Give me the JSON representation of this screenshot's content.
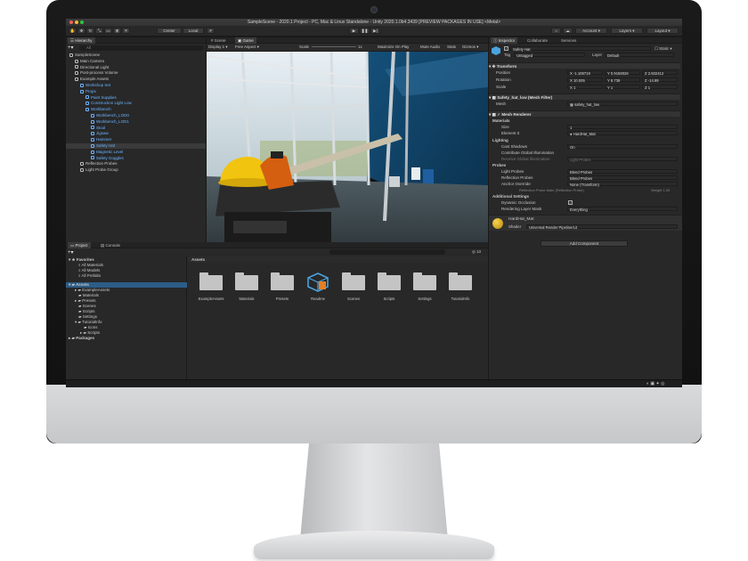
{
  "window_title": "SampleScene - 2020.1 Project - PC, Mac & Linux Standalone - Unity 2020.1.0b4.3439 [PREVIEW PACKAGES IN USE] <Metal>",
  "toolbar": {
    "center_label": "Center",
    "local_label": "Local",
    "account_label": "Account",
    "layers_label": "Layers",
    "layout_label": "Layout"
  },
  "hierarchy": {
    "tab": "Hierarchy",
    "search_placeholder": "All",
    "items": [
      {
        "label": "SampleScene",
        "indent": 0,
        "blue": false
      },
      {
        "label": "Main Camera",
        "indent": 1,
        "blue": false
      },
      {
        "label": "Directional Light",
        "indent": 1,
        "blue": false
      },
      {
        "label": "Post-process Volume",
        "indent": 1,
        "blue": false
      },
      {
        "label": "Example Assets",
        "indent": 1,
        "blue": false
      },
      {
        "label": "Workshop Set",
        "indent": 2,
        "blue": true
      },
      {
        "label": "Props",
        "indent": 2,
        "blue": true
      },
      {
        "label": "Paint Supplies",
        "indent": 3,
        "blue": true
      },
      {
        "label": "Construction Light Low",
        "indent": 3,
        "blue": true
      },
      {
        "label": "Workbench",
        "indent": 3,
        "blue": true
      },
      {
        "label": "Workbench_LOD0",
        "indent": 4,
        "blue": true
      },
      {
        "label": "Workbench_LOD1",
        "indent": 4,
        "blue": true
      },
      {
        "label": "Stool",
        "indent": 4,
        "blue": true
      },
      {
        "label": "Jigsaw",
        "indent": 4,
        "blue": true
      },
      {
        "label": "Hammer",
        "indent": 4,
        "blue": true
      },
      {
        "label": "Safety Hat",
        "indent": 4,
        "blue": true
      },
      {
        "label": "Magnetic Level",
        "indent": 4,
        "blue": true
      },
      {
        "label": "Safety Goggles",
        "indent": 4,
        "blue": true
      },
      {
        "label": "Reflection Probes",
        "indent": 2,
        "blue": false
      },
      {
        "label": "Light Probe Group",
        "indent": 2,
        "blue": false
      }
    ]
  },
  "scene": {
    "tabs": [
      "Scene",
      "Game"
    ],
    "display": "Display 1",
    "aspect": "Free Aspect",
    "scale_label": "Scale",
    "scale_value": "1x",
    "maximize": "Maximize On Play",
    "mute": "Mute Audio",
    "stats": "Stats",
    "gizmos": "Gizmos"
  },
  "project": {
    "tabs": [
      "Project",
      "Console"
    ],
    "favorites_label": "Favorites",
    "favorites": [
      "All Materials",
      "All Models",
      "All Prefabs"
    ],
    "assets_label": "Assets",
    "tree": [
      "ExampleAssets",
      "Materials",
      "Presets",
      "Scenes",
      "Scripts",
      "Settings",
      "TutorialInfo",
      "Icons",
      "Scripts"
    ],
    "packages_label": "Packages",
    "breadcrumb": "Assets",
    "folders": [
      "ExampleAssets",
      "Materials",
      "Presets",
      "Readme",
      "Scenes",
      "Scripts",
      "Settings",
      "TutorialInfo"
    ],
    "count_badge": "13"
  },
  "inspector": {
    "tabs": [
      "Inspector",
      "Collaborate",
      "Services"
    ],
    "object_name": "Safety Hat",
    "static_label": "Static",
    "tag_label": "Tag",
    "tag_value": "Untagged",
    "layer_label": "Layer",
    "layer_value": "Default",
    "transform": {
      "title": "Transform",
      "position_label": "Position",
      "position": [
        "-1.108719",
        "0.9158026",
        "2.832412"
      ],
      "rotation_label": "Rotation",
      "rotation": [
        "10.005",
        "8.739",
        "-14.89"
      ],
      "scale_label": "Scale",
      "scale": [
        "1",
        "1",
        "1"
      ]
    },
    "mesh_filter": {
      "title": "Safety_hat_low (Mesh Filter)",
      "mesh_label": "Mesh",
      "mesh_value": "safety_hat_low"
    },
    "mesh_renderer": {
      "title": "Mesh Renderer",
      "materials_label": "Materials",
      "size_label": "Size",
      "size_value": "1",
      "element_label": "Element 0",
      "element_value": "HardHat_Mat",
      "lighting_label": "Lighting",
      "cast_shadows_label": "Cast Shadows",
      "cast_shadows_value": "On",
      "contribute_gi_label": "Contribute Global Illumination",
      "receive_gi_label": "Receive Global Illumination",
      "receive_gi_value": "Light Probes",
      "probes_label": "Probes",
      "light_probes_label": "Light Probes",
      "light_probes_value": "Blend Probes",
      "reflection_probes_label": "Reflection Probes",
      "reflection_probes_value": "Blend Probes",
      "anchor_label": "Anchor Override",
      "anchor_value": "None (Transform)",
      "probe_info": "Reflection Probe Main (Reflection Probe)",
      "weight_info": "Weight 1.00",
      "additional_label": "Additional Settings",
      "dynamic_occlusion_label": "Dynamic Occlusion",
      "rendering_layer_label": "Rendering Layer Mask",
      "rendering_layer_value": "Everything"
    },
    "material": {
      "name": "HardHat_Mat",
      "shader_label": "Shader",
      "shader_value": "Universal Render Pipeline/Lit"
    },
    "add_component": "Add Component"
  }
}
